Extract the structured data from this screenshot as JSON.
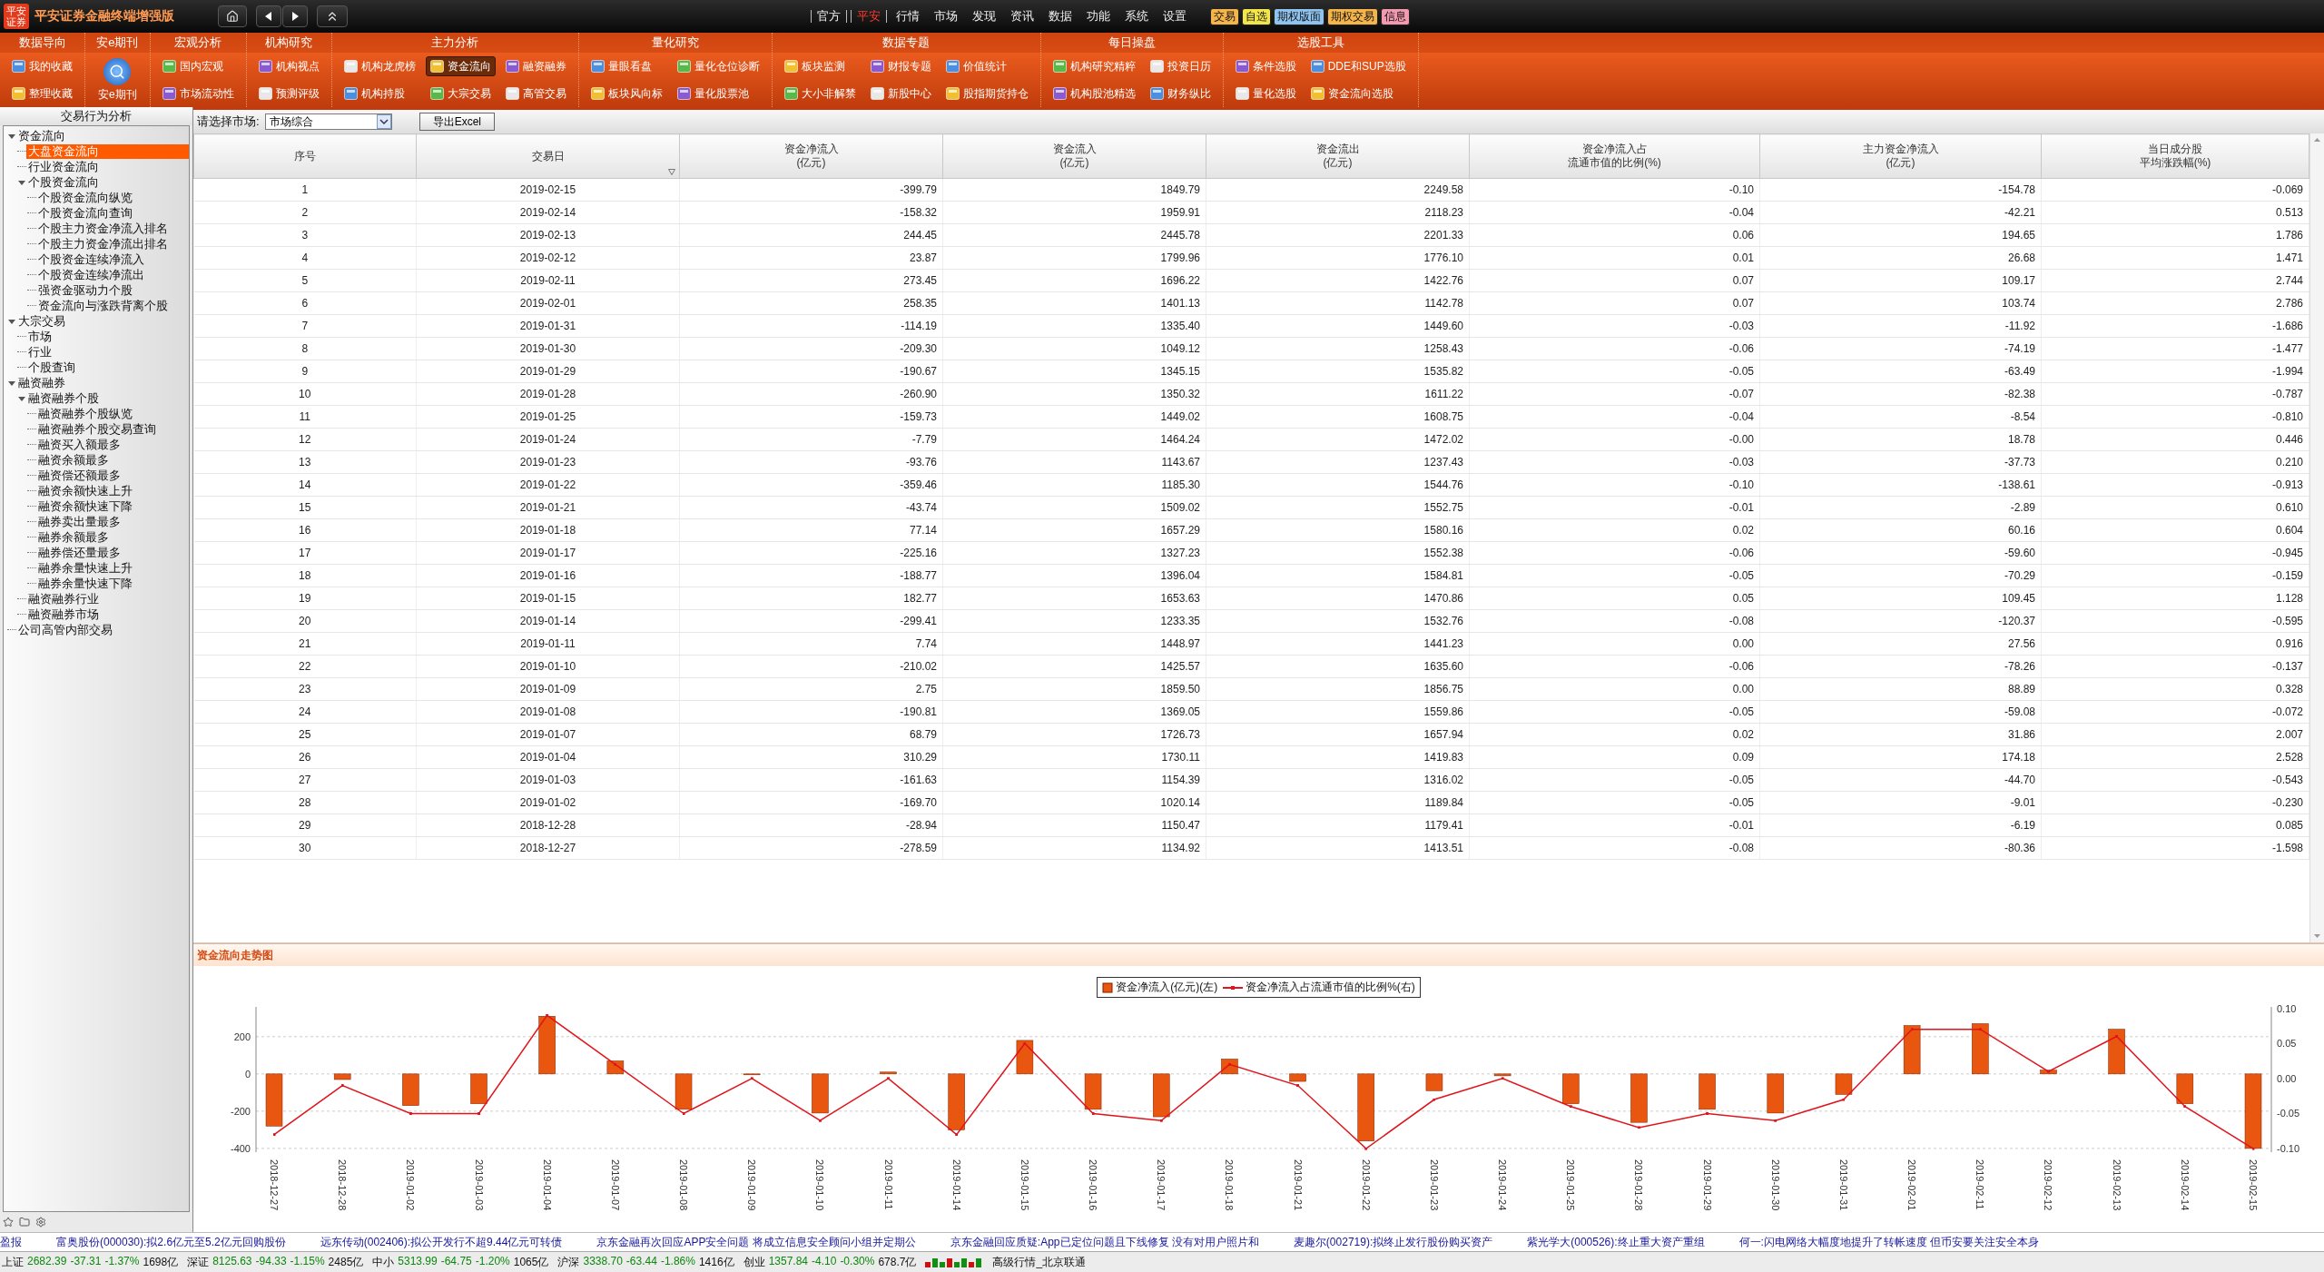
{
  "title_bar": {
    "logo_text": "平安证券",
    "app_title": "平安证券金融终端增强版"
  },
  "top_menu": [
    {
      "label": "官方",
      "selected": false
    },
    {
      "label": "平安",
      "selected": true
    },
    {
      "label": "行情",
      "selected": false
    },
    {
      "label": "市场",
      "selected": false
    },
    {
      "label": "发现",
      "selected": false
    },
    {
      "label": "资讯",
      "selected": false
    },
    {
      "label": "数据",
      "selected": false
    },
    {
      "label": "功能",
      "selected": false
    },
    {
      "label": "系统",
      "selected": false
    },
    {
      "label": "设置",
      "selected": false
    }
  ],
  "quick_badges": [
    {
      "label": "交易",
      "color": "#f5b54a"
    },
    {
      "label": "自选",
      "color": "#f2e64a"
    },
    {
      "label": "期权版面",
      "color": "#8fc4f0"
    },
    {
      "label": "期权交易",
      "color": "#f5b54a"
    },
    {
      "label": "信息",
      "color": "#f49ab0"
    }
  ],
  "ribbon": [
    {
      "title": "数据导向",
      "kind": "grid",
      "items": [
        {
          "label": "我的收藏",
          "selected": false
        },
        {
          "label": "整理收藏",
          "selected": false
        }
      ]
    },
    {
      "title": "安e期刊",
      "kind": "large",
      "items": [
        {
          "label": "安e期刊",
          "selected": false
        }
      ]
    },
    {
      "title": "宏观分析",
      "kind": "grid",
      "items": [
        {
          "label": "国内宏观",
          "selected": false
        },
        {
          "label": "市场流动性",
          "selected": false
        }
      ]
    },
    {
      "title": "机构研究",
      "kind": "grid",
      "items": [
        {
          "label": "机构视点",
          "selected": false
        },
        {
          "label": "预测评级",
          "selected": false
        }
      ]
    },
    {
      "title": "主力分析",
      "kind": "grid",
      "items": [
        {
          "label": "机构龙虎榜",
          "selected": false
        },
        {
          "label": "机构持股",
          "selected": false
        },
        {
          "label": "资金流向",
          "selected": true
        },
        {
          "label": "大宗交易",
          "selected": false
        },
        {
          "label": "融资融券",
          "selected": false
        },
        {
          "label": "高管交易",
          "selected": false
        }
      ]
    },
    {
      "title": "量化研究",
      "kind": "grid",
      "items": [
        {
          "label": "量眼看盘",
          "selected": false
        },
        {
          "label": "板块风向标",
          "selected": false
        },
        {
          "label": "量化仓位诊断",
          "selected": false
        },
        {
          "label": "量化股票池",
          "selected": false
        }
      ]
    },
    {
      "title": "数据专题",
      "kind": "grid",
      "items": [
        {
          "label": "板块监测",
          "selected": false
        },
        {
          "label": "大小非解禁",
          "selected": false
        },
        {
          "label": "财报专题",
          "selected": false
        },
        {
          "label": "新股中心",
          "selected": false
        },
        {
          "label": "价值统计",
          "selected": false
        },
        {
          "label": "股指期货持仓",
          "selected": false
        }
      ]
    },
    {
      "title": "每日操盘",
      "kind": "grid",
      "items": [
        {
          "label": "机构研究精粹",
          "selected": false
        },
        {
          "label": "机构股池精选",
          "selected": false
        },
        {
          "label": "投资日历",
          "selected": false
        },
        {
          "label": "财务纵比",
          "selected": false
        }
      ]
    },
    {
      "title": "选股工具",
      "kind": "grid",
      "items": [
        {
          "label": "条件选股",
          "selected": false
        },
        {
          "label": "量化选股",
          "selected": false
        },
        {
          "label": "DDE和SUP选股",
          "selected": false
        },
        {
          "label": "资金流向选股",
          "selected": false
        }
      ]
    }
  ],
  "sidebar": {
    "title": "交易行为分析",
    "tree": [
      {
        "label": "资金流向",
        "selected": false,
        "expanded": true,
        "children": [
          {
            "label": "大盘资金流向",
            "selected": true
          },
          {
            "label": "行业资金流向",
            "selected": false
          },
          {
            "label": "个股资金流向",
            "selected": false,
            "expanded": true,
            "children": [
              {
                "label": "个股资金流向纵览",
                "selected": false
              },
              {
                "label": "个股资金流向查询",
                "selected": false
              },
              {
                "label": "个股主力资金净流入排名",
                "selected": false
              },
              {
                "label": "个股主力资金净流出排名",
                "selected": false
              },
              {
                "label": "个股资金连续净流入",
                "selected": false
              },
              {
                "label": "个股资金连续净流出",
                "selected": false
              },
              {
                "label": "强资金驱动力个股",
                "selected": false
              },
              {
                "label": "资金流向与涨跌背离个股",
                "selected": false
              }
            ]
          }
        ]
      },
      {
        "label": "大宗交易",
        "selected": false,
        "expanded": true,
        "children": [
          {
            "label": "市场",
            "selected": false
          },
          {
            "label": "行业",
            "selected": false
          },
          {
            "label": "个股查询",
            "selected": false
          }
        ]
      },
      {
        "label": "融资融券",
        "selected": false,
        "expanded": true,
        "children": [
          {
            "label": "融资融券个股",
            "selected": false,
            "expanded": true,
            "children": [
              {
                "label": "融资融券个股纵览",
                "selected": false
              },
              {
                "label": "融资融券个股交易查询",
                "selected": false
              },
              {
                "label": "融资买入额最多",
                "selected": false
              },
              {
                "label": "融资余额最多",
                "selected": false
              },
              {
                "label": "融资偿还额最多",
                "selected": false
              },
              {
                "label": "融资余额快速上升",
                "selected": false
              },
              {
                "label": "融资余额快速下降",
                "selected": false
              },
              {
                "label": "融券卖出量最多",
                "selected": false
              },
              {
                "label": "融券余额最多",
                "selected": false
              },
              {
                "label": "融券偿还量最多",
                "selected": false
              },
              {
                "label": "融券余量快速上升",
                "selected": false
              },
              {
                "label": "融券余量快速下降",
                "selected": false
              }
            ]
          },
          {
            "label": "融资融券行业",
            "selected": false
          },
          {
            "label": "融资融券市场",
            "selected": false
          }
        ]
      },
      {
        "label": "公司高管内部交易",
        "selected": false
      }
    ]
  },
  "toolbar": {
    "market_label": "请选择市场:",
    "market_select": {
      "value": "市场综合"
    },
    "export_button": "导出Excel"
  },
  "table": {
    "columns": [
      {
        "lines": [
          "序号"
        ]
      },
      {
        "lines": [
          "交易日"
        ]
      },
      {
        "lines": [
          "资金净流入",
          "(亿元)"
        ]
      },
      {
        "lines": [
          "资金流入",
          "(亿元)"
        ]
      },
      {
        "lines": [
          "资金流出",
          "(亿元)"
        ]
      },
      {
        "lines": [
          "资金净流入占",
          "流通市值的比例(%)"
        ]
      },
      {
        "lines": [
          "主力资金净流入",
          "(亿元)"
        ]
      },
      {
        "lines": [
          "当日成分股",
          "平均涨跌幅(%)"
        ]
      }
    ],
    "rows": [
      [
        "1",
        "2019-02-15",
        "-399.79",
        "1849.79",
        "2249.58",
        "-0.10",
        "-154.78",
        "-0.069"
      ],
      [
        "2",
        "2019-02-14",
        "-158.32",
        "1959.91",
        "2118.23",
        "-0.04",
        "-42.21",
        "0.513"
      ],
      [
        "3",
        "2019-02-13",
        "244.45",
        "2445.78",
        "2201.33",
        "0.06",
        "194.65",
        "1.786"
      ],
      [
        "4",
        "2019-02-12",
        "23.87",
        "1799.96",
        "1776.10",
        "0.01",
        "26.68",
        "1.471"
      ],
      [
        "5",
        "2019-02-11",
        "273.45",
        "1696.22",
        "1422.76",
        "0.07",
        "109.17",
        "2.744"
      ],
      [
        "6",
        "2019-02-01",
        "258.35",
        "1401.13",
        "1142.78",
        "0.07",
        "103.74",
        "2.786"
      ],
      [
        "7",
        "2019-01-31",
        "-114.19",
        "1335.40",
        "1449.60",
        "-0.03",
        "-11.92",
        "-1.686"
      ],
      [
        "8",
        "2019-01-30",
        "-209.30",
        "1049.12",
        "1258.43",
        "-0.06",
        "-74.19",
        "-1.477"
      ],
      [
        "9",
        "2019-01-29",
        "-190.67",
        "1345.15",
        "1535.82",
        "-0.05",
        "-63.49",
        "-1.994"
      ],
      [
        "10",
        "2019-01-28",
        "-260.90",
        "1350.32",
        "1611.22",
        "-0.07",
        "-82.38",
        "-0.787"
      ],
      [
        "11",
        "2019-01-25",
        "-159.73",
        "1449.02",
        "1608.75",
        "-0.04",
        "-8.54",
        "-0.810"
      ],
      [
        "12",
        "2019-01-24",
        "-7.79",
        "1464.24",
        "1472.02",
        "-0.00",
        "18.78",
        "0.446"
      ],
      [
        "13",
        "2019-01-23",
        "-93.76",
        "1143.67",
        "1237.43",
        "-0.03",
        "-37.73",
        "0.210"
      ],
      [
        "14",
        "2019-01-22",
        "-359.46",
        "1185.30",
        "1544.76",
        "-0.10",
        "-138.61",
        "-0.913"
      ],
      [
        "15",
        "2019-01-21",
        "-43.74",
        "1509.02",
        "1552.75",
        "-0.01",
        "-2.89",
        "0.610"
      ],
      [
        "16",
        "2019-01-18",
        "77.14",
        "1657.29",
        "1580.16",
        "0.02",
        "60.16",
        "0.604"
      ],
      [
        "17",
        "2019-01-17",
        "-225.16",
        "1327.23",
        "1552.38",
        "-0.06",
        "-59.60",
        "-0.945"
      ],
      [
        "18",
        "2019-01-16",
        "-188.77",
        "1396.04",
        "1584.81",
        "-0.05",
        "-70.29",
        "-0.159"
      ],
      [
        "19",
        "2019-01-15",
        "182.77",
        "1653.63",
        "1470.86",
        "0.05",
        "109.45",
        "1.128"
      ],
      [
        "20",
        "2019-01-14",
        "-299.41",
        "1233.35",
        "1532.76",
        "-0.08",
        "-120.37",
        "-0.595"
      ],
      [
        "21",
        "2019-01-11",
        "7.74",
        "1448.97",
        "1441.23",
        "0.00",
        "27.56",
        "0.916"
      ],
      [
        "22",
        "2019-01-10",
        "-210.02",
        "1425.57",
        "1635.60",
        "-0.06",
        "-78.26",
        "-0.137"
      ],
      [
        "23",
        "2019-01-09",
        "2.75",
        "1859.50",
        "1856.75",
        "0.00",
        "88.89",
        "0.328"
      ],
      [
        "24",
        "2019-01-08",
        "-190.81",
        "1369.05",
        "1559.86",
        "-0.05",
        "-59.08",
        "-0.072"
      ],
      [
        "25",
        "2019-01-07",
        "68.79",
        "1726.73",
        "1657.94",
        "0.02",
        "31.86",
        "2.007"
      ],
      [
        "26",
        "2019-01-04",
        "310.29",
        "1730.11",
        "1419.83",
        "0.09",
        "174.18",
        "2.528"
      ],
      [
        "27",
        "2019-01-03",
        "-161.63",
        "1154.39",
        "1316.02",
        "-0.05",
        "-44.70",
        "-0.543"
      ],
      [
        "28",
        "2019-01-02",
        "-169.70",
        "1020.14",
        "1189.84",
        "-0.05",
        "-9.01",
        "-0.230"
      ],
      [
        "29",
        "2018-12-28",
        "-28.94",
        "1150.47",
        "1179.41",
        "-0.01",
        "-6.19",
        "0.085"
      ],
      [
        "30",
        "2018-12-27",
        "-278.59",
        "1134.92",
        "1413.51",
        "-0.08",
        "-80.36",
        "-1.598"
      ]
    ]
  },
  "chart_panel": {
    "title": "资金流向走势图",
    "chart_data": {
      "type": "bar",
      "categories": [
        "2018-12-27",
        "2018-12-28",
        "2019-01-02",
        "2019-01-03",
        "2019-01-04",
        "2019-01-07",
        "2019-01-08",
        "2019-01-09",
        "2019-01-10",
        "2019-01-11",
        "2019-01-14",
        "2019-01-15",
        "2019-01-16",
        "2019-01-17",
        "2019-01-18",
        "2019-01-21",
        "2019-01-22",
        "2019-01-23",
        "2019-01-24",
        "2019-01-25",
        "2019-01-28",
        "2019-01-29",
        "2019-01-30",
        "2019-01-31",
        "2019-02-01",
        "2019-02-11",
        "2019-02-12",
        "2019-02-13",
        "2019-02-14",
        "2019-02-15"
      ],
      "series": [
        {
          "name": "资金净流入(亿元)(左)",
          "color": "#e8560f",
          "axis": "y",
          "values": [
            -280,
            -30,
            -170,
            -160,
            310,
            70,
            -190,
            0,
            -210,
            10,
            -300,
            180,
            -190,
            -230,
            80,
            -40,
            -360,
            -90,
            -10,
            -160,
            -260,
            -190,
            -210,
            -110,
            260,
            270,
            20,
            240,
            -160,
            -400
          ]
        },
        {
          "name": "资金净流入占流通市值的比例%(右)",
          "color": "#e0141b",
          "type": "line",
          "axis": "y2",
          "values": [
            -0.08,
            -0.01,
            -0.05,
            -0.05,
            0.09,
            0.02,
            -0.05,
            0.0,
            -0.06,
            0.0,
            -0.08,
            0.05,
            -0.05,
            -0.06,
            0.02,
            -0.01,
            -0.1,
            -0.03,
            0.0,
            -0.04,
            -0.07,
            -0.05,
            -0.06,
            -0.03,
            0.07,
            0.07,
            0.01,
            0.06,
            -0.04,
            -0.1
          ]
        }
      ],
      "grid": true,
      "legend": "top",
      "ylim": [
        -420,
        360
      ],
      "yticks": [
        200,
        0,
        -200,
        -400
      ],
      "y2lim": [
        -0.105,
        0.102
      ],
      "y2ticks": [
        {
          "value": 0.1,
          "label": "0.10"
        },
        {
          "value": 0.05,
          "label": "0.05"
        },
        {
          "value": 0,
          "label": "0.00"
        },
        {
          "value": -0.05,
          "label": "-0.05"
        },
        {
          "value": -0.1,
          "label": "-0.10"
        }
      ]
    }
  },
  "news_ticker": [
    "盈报",
    "富奥股份(000030):拟2.6亿元至5.2亿元回购股份",
    "远东传动(002406):拟公开发行不超9.44亿元可转债",
    "京东金融再次回应APP安全问题 将成立信息安全顾问小组并定期公",
    "京东金融回应质疑:App已定位问题且下线修复 没有对用户照片和",
    "麦趣尔(002719):拟终止发行股份购买资产",
    "紫光学大(000526):终止重大资产重组",
    "何一:闪电网络大幅度地提升了转帐速度 但币安要关注安全本身"
  ],
  "status_bar": {
    "indices": [
      {
        "name": "上证",
        "value": "2682.39",
        "change": "-37.31",
        "percent": "-1.37%",
        "amount": "1698亿",
        "color": "#0a8a0a"
      },
      {
        "name": "深证",
        "value": "8125.63",
        "change": "-94.33",
        "percent": "-1.15%",
        "amount": "2485亿",
        "color": "#0a8a0a"
      },
      {
        "name": "中小",
        "value": "5313.99",
        "change": "-64.75",
        "percent": "-1.20%",
        "amount": "1065亿",
        "color": "#0a8a0a"
      },
      {
        "name": "沪深",
        "value": "3338.70",
        "change": "-63.44",
        "percent": "-1.86%",
        "amount": "1416亿",
        "color": "#0a8a0a"
      },
      {
        "name": "创业",
        "value": "1357.84",
        "change": "-4.10",
        "percent": "-0.30%",
        "amount": "678.7亿",
        "color": "#0a8a0a"
      }
    ],
    "connection": "高级行情_北京联通"
  }
}
